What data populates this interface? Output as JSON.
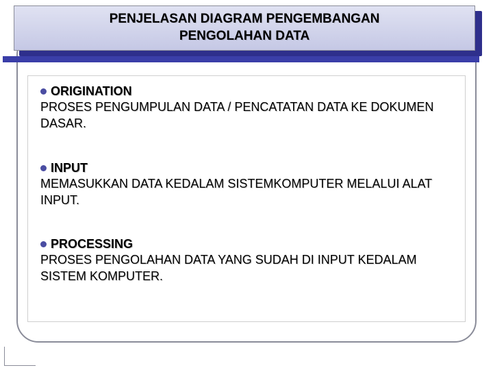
{
  "title": "PENJELASAN DIAGRAM PENGEMBANGAN\nPENGOLAHAN DATA",
  "items": [
    {
      "heading": "ORIGINATION",
      "body": "PROSES PENGUMPULAN DATA / PENCATATAN DATA KE DOKUMEN DASAR."
    },
    {
      "heading": "INPUT",
      "body": "MEMASUKKAN DATA KEDALAM SISTEMKOMPUTER MELALUI ALAT INPUT."
    },
    {
      "heading": "PROCESSING",
      "body": "PROSES PENGOLAHAN DATA YANG SUDAH DI INPUT KEDALAM SISTEM KOMPUTER."
    }
  ]
}
